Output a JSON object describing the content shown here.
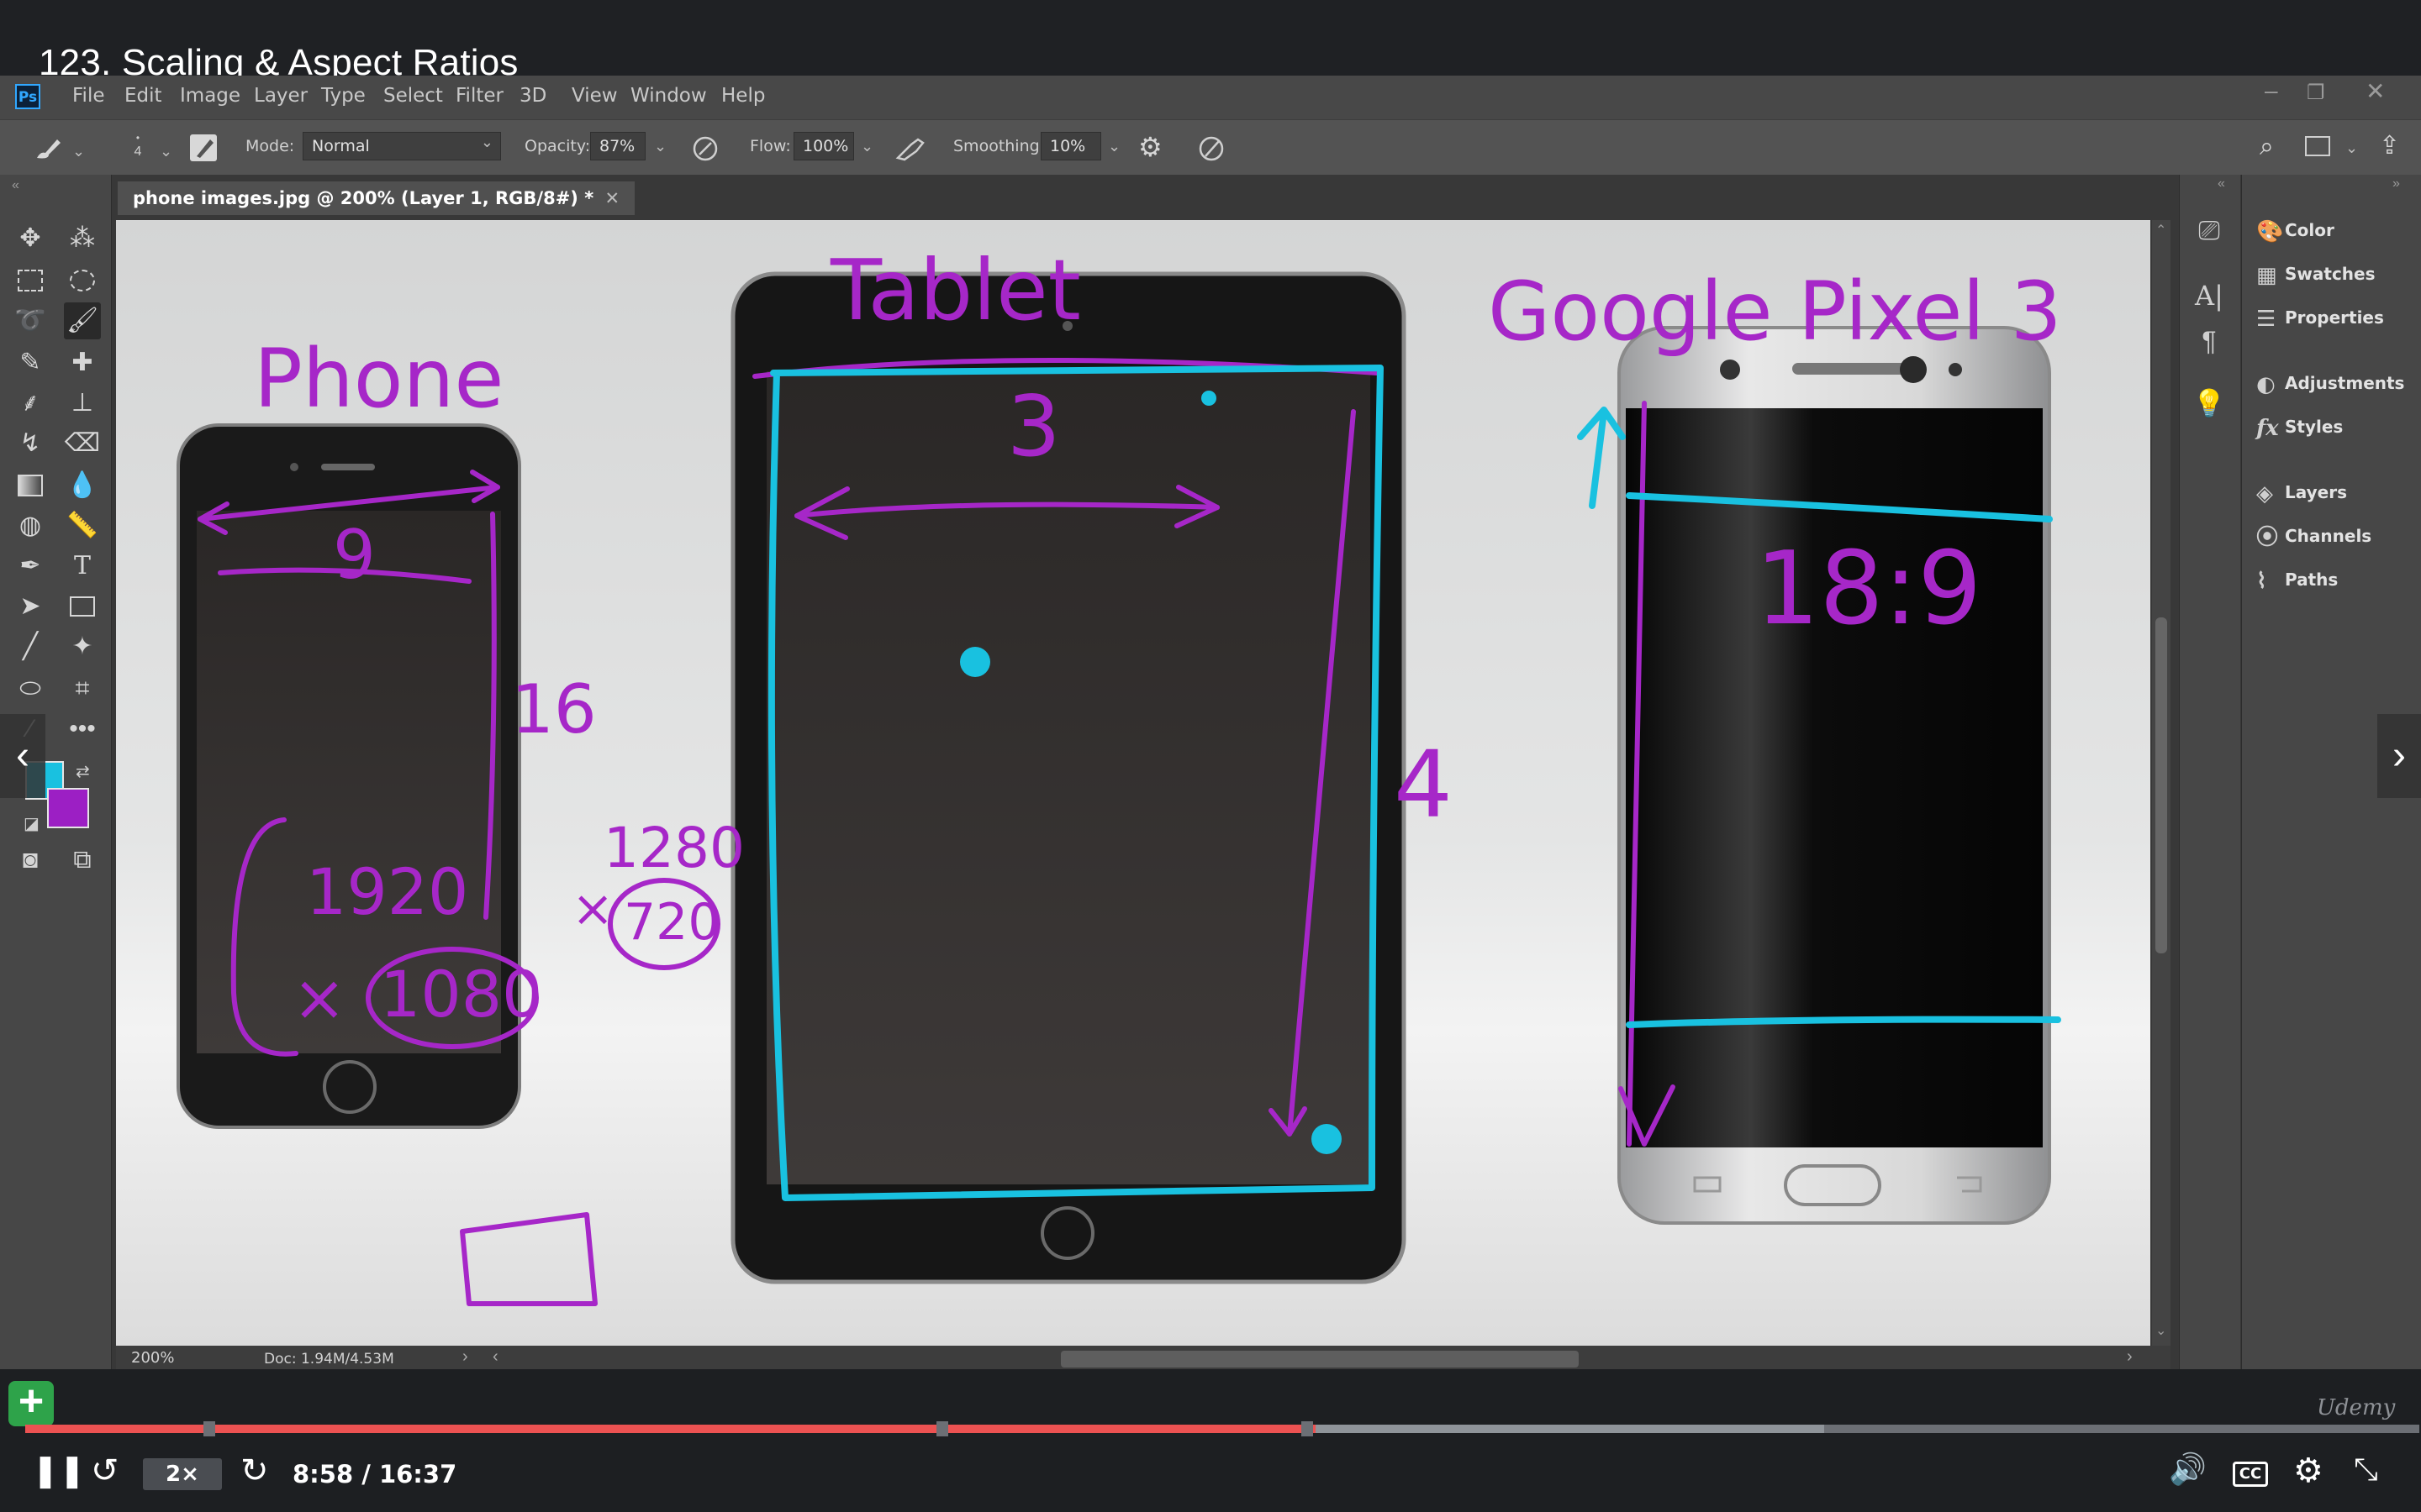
{
  "video": {
    "title": "123. Scaling & Aspect Ratios"
  },
  "photoshop": {
    "logo": "Ps",
    "menu": [
      "File",
      "Edit",
      "Image",
      "Layer",
      "Type",
      "Select",
      "Filter",
      "3D",
      "View",
      "Window",
      "Help"
    ],
    "options": {
      "brush_size": "4",
      "mode_label": "Mode:",
      "mode_value": "Normal",
      "opacity_label": "Opacity:",
      "opacity_value": "87%",
      "flow_label": "Flow:",
      "flow_value": "100%",
      "smoothing_label": "Smoothing:",
      "smoothing_value": "10%"
    },
    "document_tab": "phone images.jpg @ 200% (Layer 1, RGB/8#) *",
    "status": {
      "zoom": "200%",
      "doc_size": "Doc: 1.94M/4.53M"
    },
    "panels": [
      "Color",
      "Swatches",
      "Properties",
      "Adjustments",
      "Styles",
      "Layers",
      "Channels",
      "Paths"
    ],
    "colors": {
      "foreground": "#19c1e0",
      "background": "#9c1fc4"
    }
  },
  "canvas": {
    "annotations": {
      "phone_label": "Phone",
      "phone_width": "9",
      "phone_height": "16",
      "phone_res_w": "1920",
      "phone_res_x": "×",
      "phone_res_h": "1080",
      "small_res_w": "1280",
      "small_res_x": "×",
      "small_res_h": "720",
      "tablet_label": "Tablet",
      "tablet_width": "3",
      "tablet_height": "4",
      "pixel_label": "Google Pixel 3",
      "pixel_ratio": "18:9"
    },
    "ink_colors": {
      "purple": "#a627c8",
      "cyan": "#19c1e0"
    }
  },
  "player": {
    "speed": "2×",
    "current_time": "8:58",
    "separator": " / ",
    "duration": "16:37",
    "progress_fraction": 0.539,
    "brand": "Udemy",
    "cc_label": "CC"
  }
}
